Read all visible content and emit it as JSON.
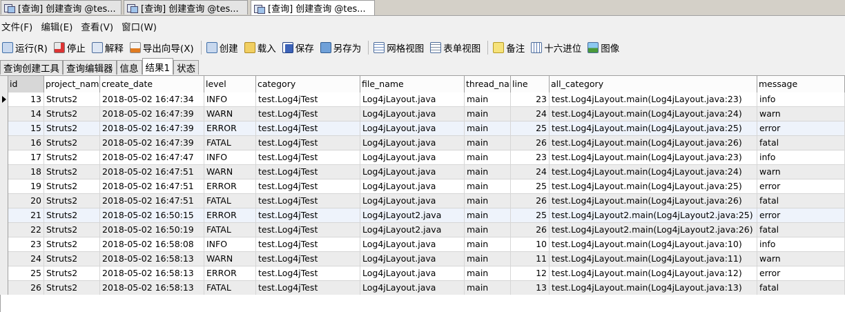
{
  "doc_tabs": [
    {
      "title": "[查询] 创建查询 @tes..."
    },
    {
      "title": "[查询] 创建查询 @tes..."
    },
    {
      "title": "[查询] 创建查询 @tes..."
    }
  ],
  "menu": [
    "文件(F)",
    "编辑(E)",
    "查看(V)",
    "窗口(W)"
  ],
  "toolbar": {
    "run": "运行(R)",
    "stop": "停止",
    "explain": "解释",
    "export_wizard": "导出向导(X)",
    "create": "创建",
    "load": "载入",
    "save": "保存",
    "save_as": "另存为",
    "grid_view": "网格视图",
    "form_view": "表单视图",
    "memo": "备注",
    "hex": "十六进位",
    "image": "图像"
  },
  "result_tabs": [
    "查询创建工具",
    "查询编辑器",
    "信息",
    "结果1",
    "状态"
  ],
  "grid": {
    "columns": [
      "id",
      "project_name",
      "create_date",
      "level",
      "category",
      "file_name",
      "thread_name",
      "line",
      "all_category",
      "message"
    ],
    "rows": [
      [
        "13",
        "Struts2",
        "2018-05-02 16:47:34",
        "INFO",
        "test.Log4jTest",
        "Log4jLayout.java",
        "main",
        "23",
        "test.Log4jLayout.main(Log4jLayout.java:23)",
        "info"
      ],
      [
        "14",
        "Struts2",
        "2018-05-02 16:47:39",
        "WARN",
        "test.Log4jTest",
        "Log4jLayout.java",
        "main",
        "24",
        "test.Log4jLayout.main(Log4jLayout.java:24)",
        "warn"
      ],
      [
        "15",
        "Struts2",
        "2018-05-02 16:47:39",
        "ERROR",
        "test.Log4jTest",
        "Log4jLayout.java",
        "main",
        "25",
        "test.Log4jLayout.main(Log4jLayout.java:25)",
        "error"
      ],
      [
        "16",
        "Struts2",
        "2018-05-02 16:47:39",
        "FATAL",
        "test.Log4jTest",
        "Log4jLayout.java",
        "main",
        "26",
        "test.Log4jLayout.main(Log4jLayout.java:26)",
        "fatal"
      ],
      [
        "17",
        "Struts2",
        "2018-05-02 16:47:47",
        "INFO",
        "test.Log4jTest",
        "Log4jLayout.java",
        "main",
        "23",
        "test.Log4jLayout.main(Log4jLayout.java:23)",
        "info"
      ],
      [
        "18",
        "Struts2",
        "2018-05-02 16:47:51",
        "WARN",
        "test.Log4jTest",
        "Log4jLayout.java",
        "main",
        "24",
        "test.Log4jLayout.main(Log4jLayout.java:24)",
        "warn"
      ],
      [
        "19",
        "Struts2",
        "2018-05-02 16:47:51",
        "ERROR",
        "test.Log4jTest",
        "Log4jLayout.java",
        "main",
        "25",
        "test.Log4jLayout.main(Log4jLayout.java:25)",
        "error"
      ],
      [
        "20",
        "Struts2",
        "2018-05-02 16:47:51",
        "FATAL",
        "test.Log4jTest",
        "Log4jLayout.java",
        "main",
        "26",
        "test.Log4jLayout.main(Log4jLayout.java:26)",
        "fatal"
      ],
      [
        "21",
        "Struts2",
        "2018-05-02 16:50:15",
        "ERROR",
        "test.Log4jTest",
        "Log4jLayout2.java",
        "main",
        "25",
        "test.Log4jLayout2.main(Log4jLayout2.java:25)",
        "error"
      ],
      [
        "22",
        "Struts2",
        "2018-05-02 16:50:19",
        "FATAL",
        "test.Log4jTest",
        "Log4jLayout2.java",
        "main",
        "26",
        "test.Log4jLayout2.main(Log4jLayout2.java:26)",
        "fatal"
      ],
      [
        "23",
        "Struts2",
        "2018-05-02 16:58:08",
        "INFO",
        "test.Log4jTest",
        "Log4jLayout.java",
        "main",
        "10",
        "test.Log4jLayout.main(Log4jLayout.java:10)",
        "info"
      ],
      [
        "24",
        "Struts2",
        "2018-05-02 16:58:13",
        "WARN",
        "test.Log4jTest",
        "Log4jLayout.java",
        "main",
        "11",
        "test.Log4jLayout.main(Log4jLayout.java:11)",
        "warn"
      ],
      [
        "25",
        "Struts2",
        "2018-05-02 16:58:13",
        "ERROR",
        "test.Log4jTest",
        "Log4jLayout.java",
        "main",
        "12",
        "test.Log4jLayout.main(Log4jLayout.java:12)",
        "error"
      ],
      [
        "26",
        "Struts2",
        "2018-05-02 16:58:13",
        "FATAL",
        "test.Log4jTest",
        "Log4jLayout.java",
        "main",
        "13",
        "test.Log4jLayout.main(Log4jLayout.java:13)",
        "fatal"
      ]
    ]
  },
  "colors": {
    "selected_row": "#eef3fb",
    "alt_row": "#ececec",
    "header_sorted": "#d7d7d7"
  }
}
